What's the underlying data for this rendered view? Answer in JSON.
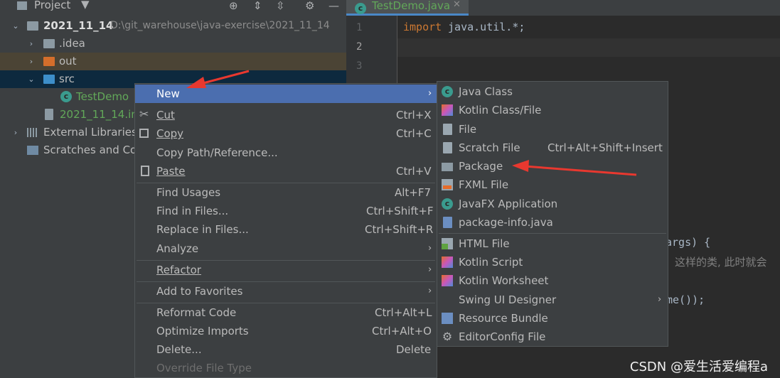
{
  "project_panel": {
    "title": "Project",
    "tree": [
      {
        "label": "2021_11_14",
        "path": "D:\\git_warehouse\\java-exercise\\2021_11_14"
      },
      {
        "label": ".idea"
      },
      {
        "label": "out"
      },
      {
        "label": "src"
      },
      {
        "label": "TestDemo"
      },
      {
        "label": "2021_11_14.im"
      },
      {
        "label": "External Libraries"
      },
      {
        "label": "Scratches and Cor"
      }
    ]
  },
  "editor": {
    "tab_label": "TestDemo.java",
    "line_numbers": [
      "1",
      "2",
      "3"
    ],
    "code": {
      "line1_keyword": "import",
      "line1_rest": " java.util.*;",
      "fragment_args": "args) {",
      "fragment_comment": "这样的类, 此时就会",
      "fragment_name": "me());"
    }
  },
  "context_menu": {
    "items": [
      {
        "label": "New",
        "shortcut": ""
      },
      {
        "label": "Cut",
        "shortcut": "Ctrl+X"
      },
      {
        "label": "Copy",
        "shortcut": "Ctrl+C"
      },
      {
        "label": "Copy Path/Reference...",
        "shortcut": ""
      },
      {
        "label": "Paste",
        "shortcut": "Ctrl+V"
      },
      {
        "label": "Find Usages",
        "shortcut": "Alt+F7"
      },
      {
        "label": "Find in Files...",
        "shortcut": "Ctrl+Shift+F"
      },
      {
        "label": "Replace in Files...",
        "shortcut": "Ctrl+Shift+R"
      },
      {
        "label": "Analyze",
        "shortcut": ""
      },
      {
        "label": "Refactor",
        "shortcut": ""
      },
      {
        "label": "Add to Favorites",
        "shortcut": ""
      },
      {
        "label": "Reformat Code",
        "shortcut": "Ctrl+Alt+L"
      },
      {
        "label": "Optimize Imports",
        "shortcut": "Ctrl+Alt+O"
      },
      {
        "label": "Delete...",
        "shortcut": "Delete"
      },
      {
        "label": "Override File Type",
        "shortcut": ""
      }
    ]
  },
  "new_submenu": {
    "items": [
      {
        "label": "Java Class",
        "shortcut": ""
      },
      {
        "label": "Kotlin Class/File",
        "shortcut": ""
      },
      {
        "label": "File",
        "shortcut": ""
      },
      {
        "label": "Scratch File",
        "shortcut": "Ctrl+Alt+Shift+Insert"
      },
      {
        "label": "Package",
        "shortcut": ""
      },
      {
        "label": "FXML File",
        "shortcut": ""
      },
      {
        "label": "JavaFX Application",
        "shortcut": ""
      },
      {
        "label": "package-info.java",
        "shortcut": ""
      },
      {
        "label": "HTML File",
        "shortcut": ""
      },
      {
        "label": "Kotlin Script",
        "shortcut": ""
      },
      {
        "label": "Kotlin Worksheet",
        "shortcut": ""
      },
      {
        "label": "Swing UI Designer",
        "shortcut": ""
      },
      {
        "label": "Resource Bundle",
        "shortcut": ""
      },
      {
        "label": "EditorConfig File",
        "shortcut": ""
      }
    ]
  },
  "watermark": "CSDN @爱生活爱编程a",
  "colors": {
    "selection": "#4b6eaf",
    "tree_selected": "#0d293e",
    "out_row": "#4b4435",
    "annotation_arrow": "#e8382f",
    "keyword": "#cc7832"
  }
}
